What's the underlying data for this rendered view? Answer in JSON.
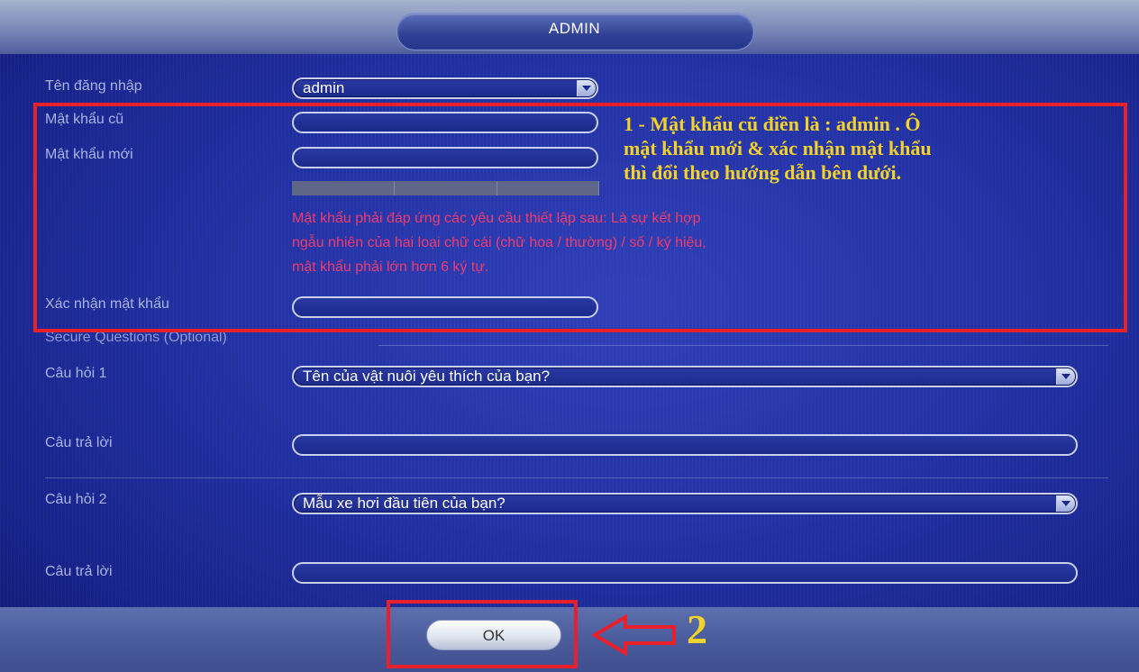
{
  "header": {
    "title": "ADMIN"
  },
  "form": {
    "username": {
      "label": "Tên đăng nhập",
      "value": "admin"
    },
    "old_password": {
      "label": "Mật khẩu cũ",
      "value": ""
    },
    "new_password": {
      "label": "Mật khẩu mới",
      "value": ""
    },
    "password_rules": [
      "Mật khẩu phải đáp ứng các yêu cầu thiết lập sau: Là sự kết hợp",
      "ngẫu nhiên của hai loại chữ cái (chữ hoa / thường) / số / ký hiệu,",
      "mật khẩu phải lớn hơn 6 ký tự."
    ],
    "confirm_password": {
      "label": "Xác nhận mật khẩu",
      "value": ""
    },
    "secure_questions_title": "Secure Questions (Optional)",
    "question1": {
      "label": "Câu hỏi 1",
      "value": "Tên của vật nuôi yêu thích của bạn?"
    },
    "answer1": {
      "label": "Câu trả lời",
      "value": ""
    },
    "question2": {
      "label": "Câu hỏi 2",
      "value": "Mẫu xe hơi đầu tiên của bạn?"
    },
    "answer2": {
      "label": "Câu trả lời",
      "value": ""
    }
  },
  "annotations": {
    "note1": [
      "1 - Mật khẩu cũ điền là : admin . Ô",
      "mật khẩu mới & xác nhận mật khẩu",
      "thì đổi theo hướng dẫn bên dưới."
    ],
    "step2": "2",
    "highlight_color": "#e8202a",
    "text_color": "#f3d22b"
  },
  "footer": {
    "ok_label": "OK"
  },
  "icons": {
    "dropdown": "chevron-down-icon",
    "arrow": "left-arrow-icon"
  }
}
